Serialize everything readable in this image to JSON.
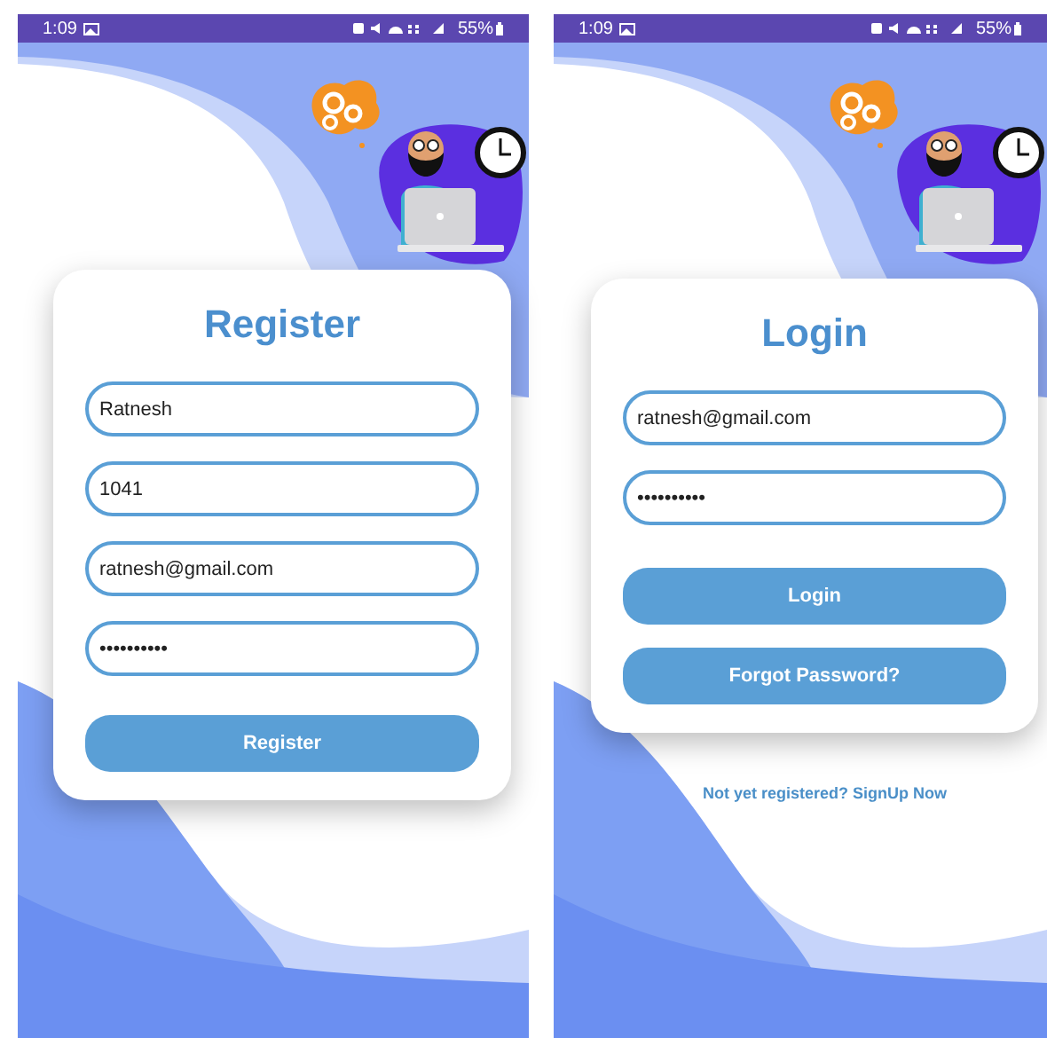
{
  "screens": [
    {
      "status_bar": {
        "time": "1:09",
        "battery": "55%"
      },
      "card": {
        "title": "Register",
        "fields": [
          {
            "value": "Ratnesh"
          },
          {
            "value": "1041"
          },
          {
            "value": "ratnesh@gmail.com"
          },
          {
            "value": "••••••••••"
          }
        ],
        "buttons": [
          "Register"
        ]
      }
    },
    {
      "status_bar": {
        "time": "1:09",
        "battery": "55%"
      },
      "card": {
        "title": "Login",
        "fields": [
          {
            "value": "ratnesh@gmail.com"
          },
          {
            "value": "••••••••••"
          }
        ],
        "buttons": [
          "Login",
          "Forgot Password?"
        ]
      },
      "link": "Not yet registered? SignUp Now"
    }
  ]
}
